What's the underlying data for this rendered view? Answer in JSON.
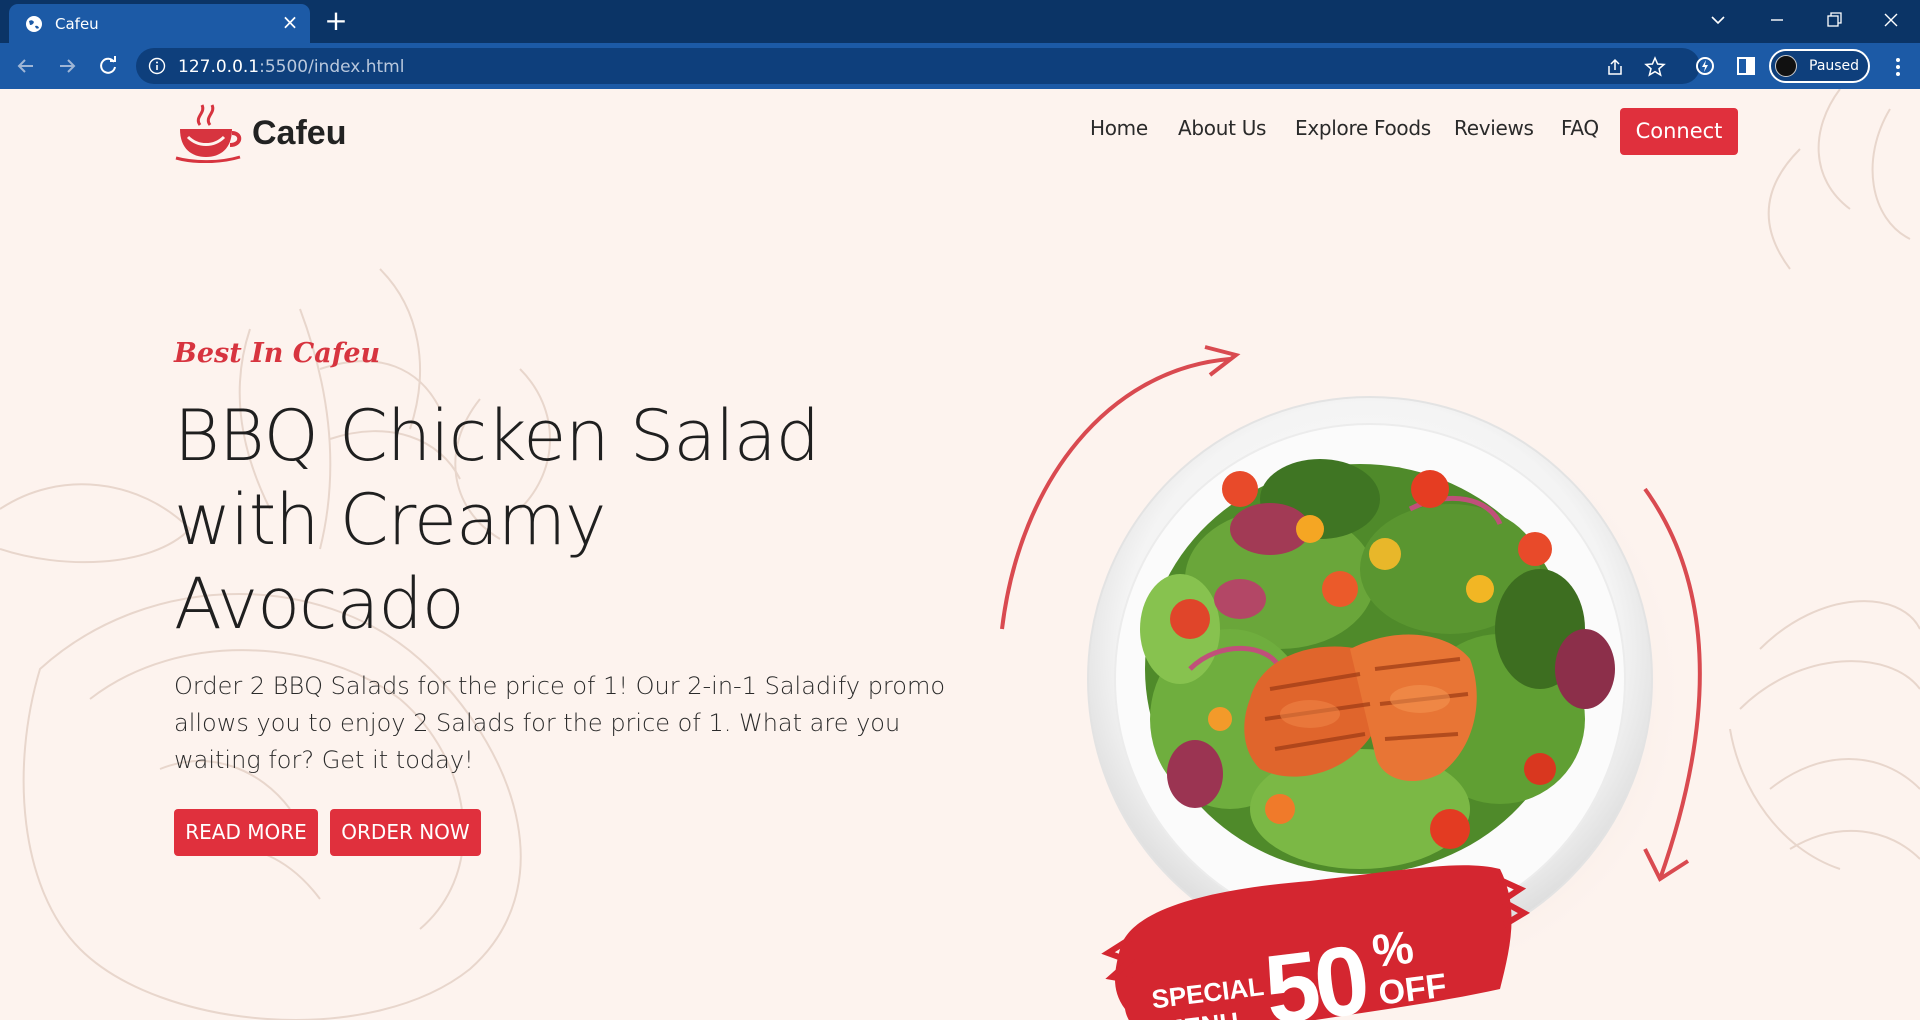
{
  "browser": {
    "tab_title": "Cafeu",
    "url_host": "127.0.0.1",
    "url_rest": ":5500/index.html",
    "profile_status": "Paused"
  },
  "site": {
    "brand": "Cafeu",
    "nav": [
      "Home",
      "About Us",
      "Explore Foods",
      "Reviews",
      "FAQ"
    ],
    "cta": "Connect"
  },
  "hero": {
    "eyebrow": "Best In Cafeu",
    "title_lines": [
      "BBQ Chicken Salad",
      "with Creamy",
      "Avocado"
    ],
    "description_lines": [
      "Order 2 BBQ Salads for the price of 1! Our 2-in-1 Saladify promo",
      "allows you to enjoy 2 Salads for the price of 1. What are you",
      "waiting for? Get it today!"
    ],
    "read_more": "READ MORE",
    "order_now": "ORDER NOW"
  },
  "promo_badge": {
    "word1": "SPECIAL",
    "word2": "MENU",
    "big": "50",
    "percent": "%",
    "off": "OFF"
  },
  "colors": {
    "accent": "#e0303d",
    "page_bg": "#fdf3ee",
    "chrome_dark": "#0b3466",
    "chrome_light": "#1c5aa6"
  }
}
